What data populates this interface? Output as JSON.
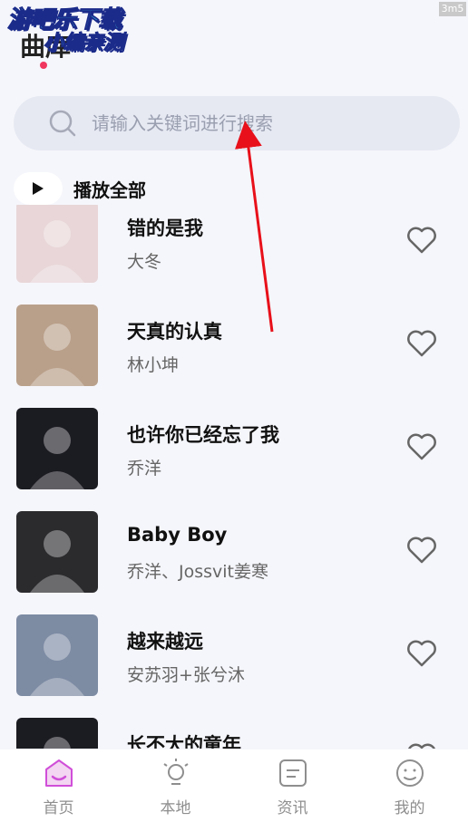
{
  "watermark": {
    "line1": "游吧乐下载",
    "line2": "小编亲测",
    "corner": "3m5"
  },
  "header": {
    "title": "曲库"
  },
  "search": {
    "placeholder": "请输入关键词进行搜索"
  },
  "play_all": {
    "label": "播放全部"
  },
  "songs": [
    {
      "title": "错的是我",
      "artist": "大冬",
      "cover_color": "#e8d6d8"
    },
    {
      "title": "天真的认真",
      "artist": "林小坤",
      "cover_color": "#b9a08a"
    },
    {
      "title": "也许你已经忘了我",
      "artist": "乔洋",
      "cover_color": "#1b1b22"
    },
    {
      "title": "Baby Boy",
      "artist": "乔洋、Jossvit姜寒",
      "cover_color": "#2b2b2e"
    },
    {
      "title": "越来越远",
      "artist": "安苏羽+张兮沐",
      "cover_color": "#7d8ba3"
    },
    {
      "title": "长不大的童年",
      "artist": "",
      "cover_color": "#1b1b22"
    }
  ],
  "tabs": [
    {
      "label": "首页",
      "icon": "home-icon",
      "active": true
    },
    {
      "label": "本地",
      "icon": "bulb-icon",
      "active": false
    },
    {
      "label": "资讯",
      "icon": "news-icon",
      "active": false
    },
    {
      "label": "我的",
      "icon": "profile-icon",
      "active": false
    }
  ],
  "colors": {
    "accent": "#e23a6b",
    "annotation": "#e8101a",
    "background": "#f5f6fb"
  }
}
